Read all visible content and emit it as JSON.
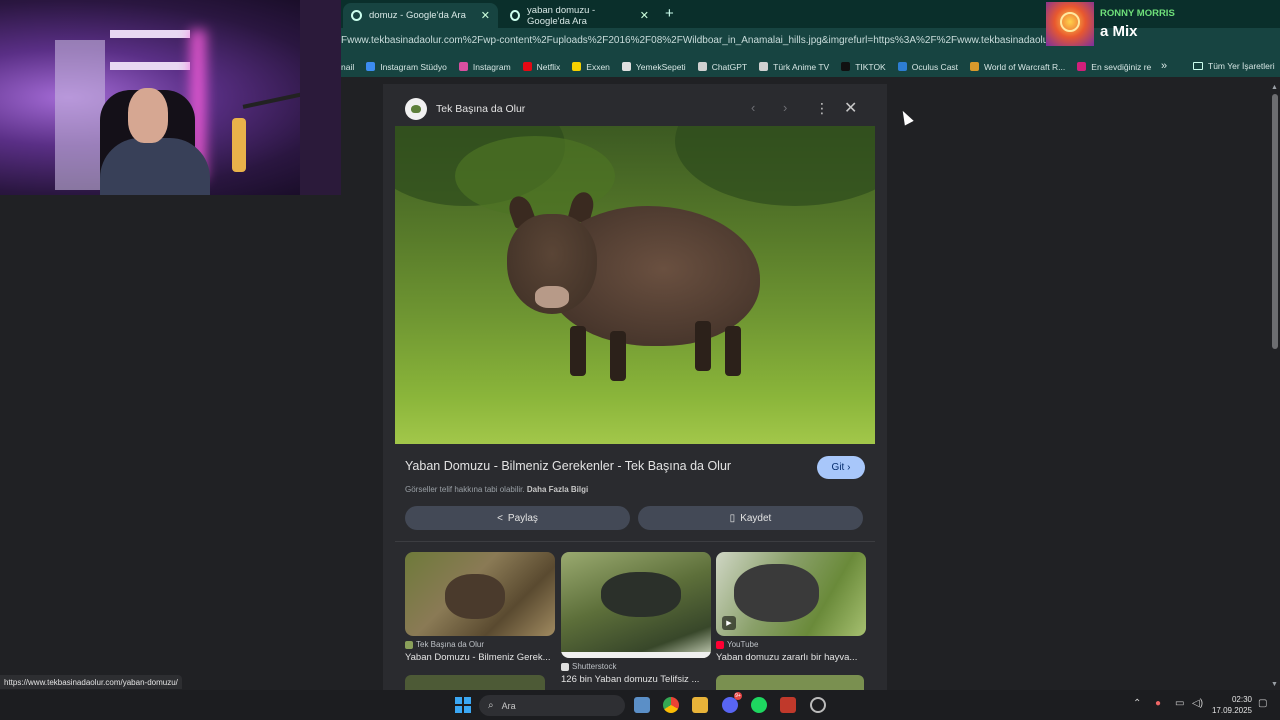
{
  "tabs": [
    {
      "label": "domuz - Google'da Ara",
      "active": true
    },
    {
      "label": "yaban domuzu - Google'da Ara",
      "active": false
    }
  ],
  "address_bar": {
    "url": "Fwww.tekbasinadaolur.com%2Fwp-content%2Fuploads%2F2016%2F08%2FWildboar_in_Anamalai_hills.jpg&imgrefurl=https%3A%2F%2Fwww.tekbasinadaolur.com%2Fyaban"
  },
  "now_playing": {
    "artist": "RONNY MORRIS",
    "title": "a Mix"
  },
  "bookmarks": [
    {
      "label": "nail",
      "color": "#7a7a7a"
    },
    {
      "label": "Instagram Stüdyo",
      "color": "#3c8cf0"
    },
    {
      "label": "Instagram",
      "color": "#d94fa0"
    },
    {
      "label": "Netflix",
      "color": "#e50914"
    },
    {
      "label": "Exxen",
      "color": "#f5d000"
    },
    {
      "label": "YemekSepeti",
      "color": "#e0e0e0"
    },
    {
      "label": "ChatGPT",
      "color": "#d0d0d0"
    },
    {
      "label": "Türk Anime TV",
      "color": "#d0d0d0"
    },
    {
      "label": "TIKTOK",
      "color": "#111111"
    },
    {
      "label": "Oculus Cast",
      "color": "#2d7dd2"
    },
    {
      "label": "World of Warcraft R...",
      "color": "#d99a2b"
    },
    {
      "label": "En sevdiğiniz restor...",
      "color": "#d21f7a"
    }
  ],
  "bookmarks_more": "»",
  "all_bookmarks": "Tüm Yer İşaretleri",
  "viewer": {
    "source_name": "Tek Başına da Olur",
    "title": "Yaban Domuzu - Bilmeniz Gerekenler - Tek Başına da Olur",
    "go_label": "Git",
    "copyright_text": "Görseller telif hakkına tabi olabilir.",
    "copyright_link": "Daha Fazla Bilgi",
    "share_label": "Paylaş",
    "save_label": "Kaydet"
  },
  "related": [
    {
      "source": "Tek Başına da Olur",
      "title": "Yaban Domuzu - Bilmeniz Gerek...",
      "source_color": "#8aa05a",
      "video": false
    },
    {
      "source": "Shutterstock",
      "title": "126 bin Yaban domuzu Telifsiz ...",
      "source_color": "#e0e0e0",
      "video": false
    },
    {
      "source": "YouTube",
      "title": "Yaban domuzu zararlı bir hayva...",
      "source_color": "#ff0033",
      "video": true
    }
  ],
  "status_url": "https://www.tekbasinadaolur.com/yaban-domuzu/",
  "taskbar": {
    "search_placeholder": "Ara",
    "time": "02:30",
    "date": "17.09.2025",
    "discord_badge": "9+"
  }
}
